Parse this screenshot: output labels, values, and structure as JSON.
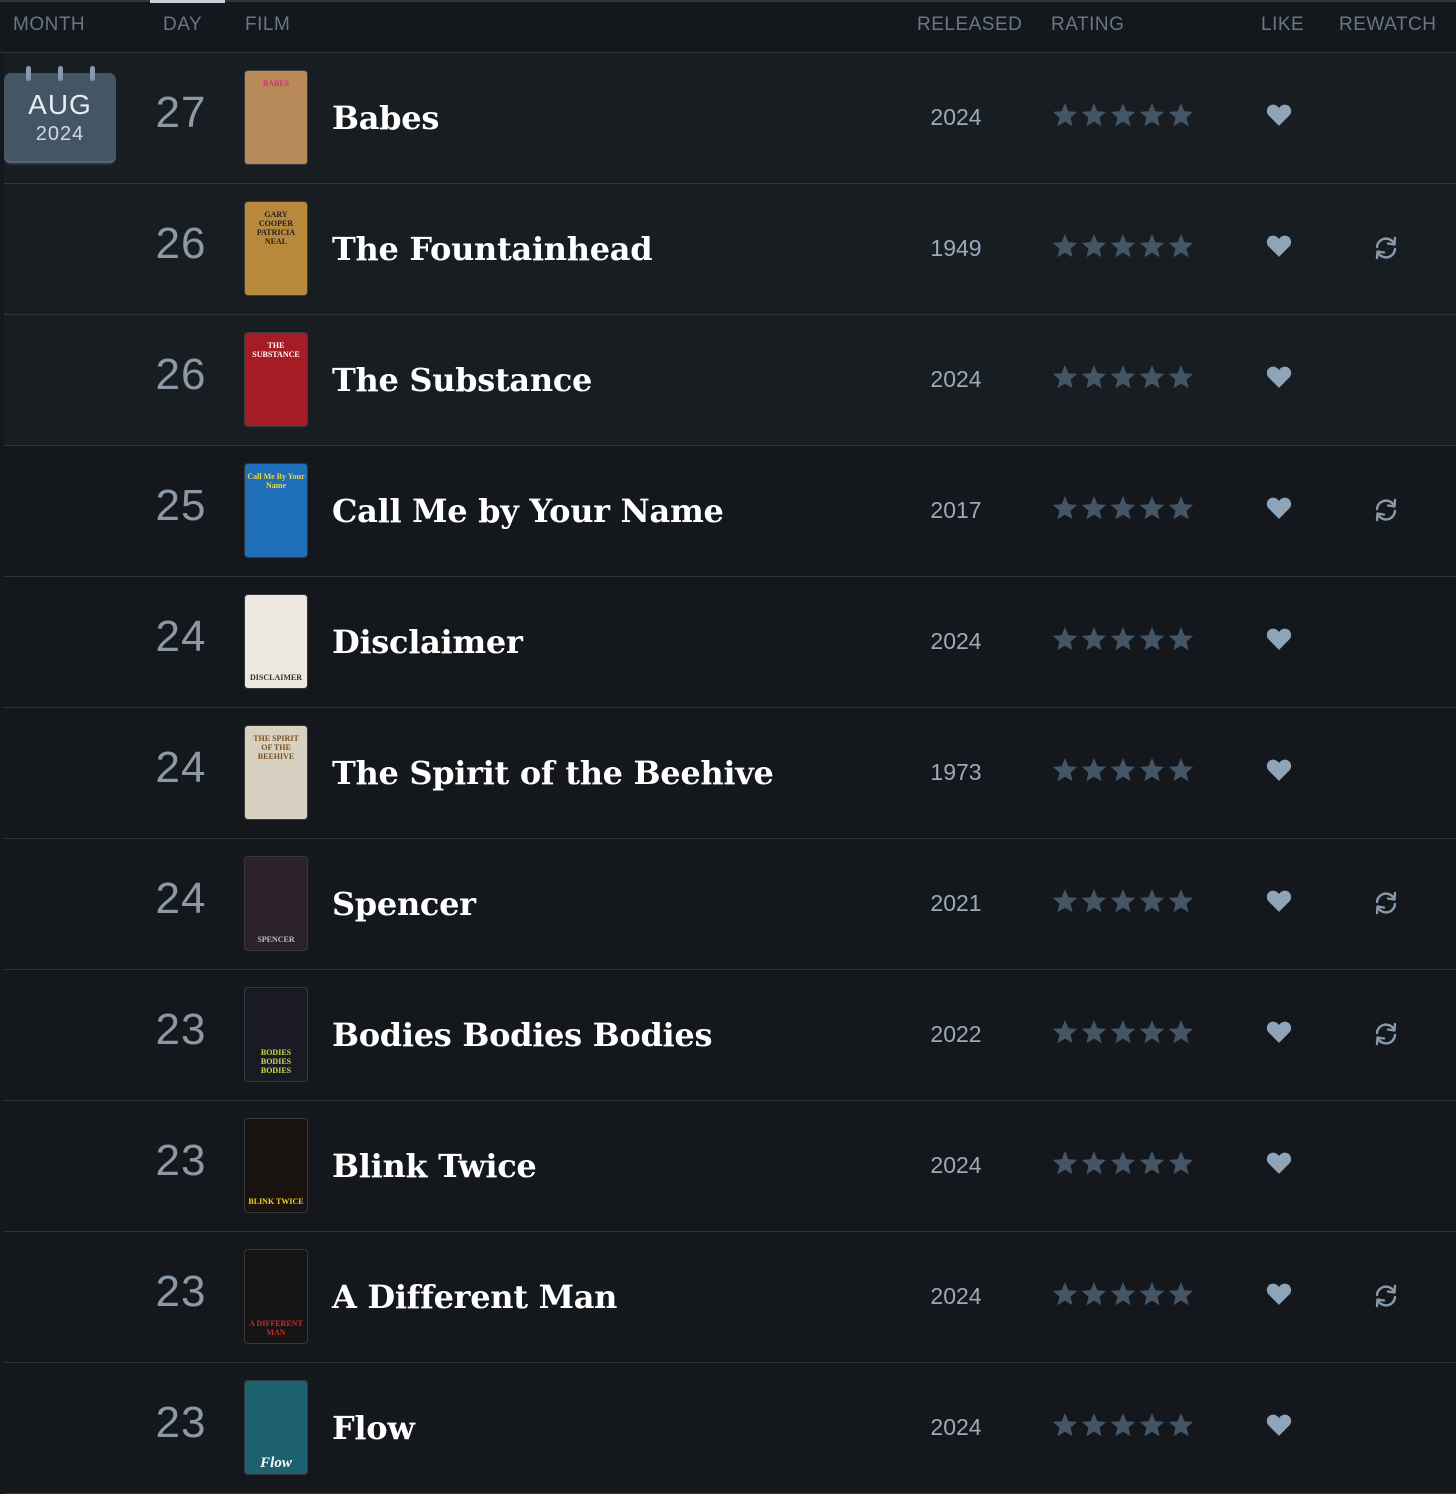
{
  "header": {
    "month": "MONTH",
    "day": "DAY",
    "film": "FILM",
    "released": "RELEASED",
    "rating": "RATING",
    "like": "LIKE",
    "rewatch": "REWATCH"
  },
  "calendar": {
    "month": "AUG",
    "year": "2024"
  },
  "entries": [
    {
      "day": "27",
      "title": "Babes",
      "year": "2024",
      "rating": 5,
      "liked": true,
      "rewatch": false,
      "poster": {
        "bg": "#b88a5a",
        "text": "BABES",
        "text_color": "#e8228a"
      }
    },
    {
      "day": "26",
      "title": "The Fountainhead",
      "year": "1949",
      "rating": 5,
      "liked": true,
      "rewatch": true,
      "poster": {
        "bg": "#b8893a",
        "text": "GARY COOPER PATRICIA NEAL",
        "text_color": "#222"
      }
    },
    {
      "day": "26",
      "title": "The Substance",
      "year": "2024",
      "rating": 5,
      "liked": true,
      "rewatch": false,
      "poster": {
        "bg": "#a51c25",
        "text": "THE SUBSTANCE",
        "text_color": "#fff"
      }
    },
    {
      "day": "25",
      "title": "Call Me by Your Name",
      "year": "2017",
      "rating": 5,
      "liked": true,
      "rewatch": true,
      "poster": {
        "bg": "#1f6fb8",
        "text": "Call Me By Your Name",
        "text_color": "#e8d840"
      }
    },
    {
      "day": "24",
      "title": "Disclaimer",
      "year": "2024",
      "rating": 5,
      "liked": true,
      "rewatch": false,
      "poster": {
        "bg": "#ece8e0",
        "text": "DISCLAIMER",
        "text_color": "#333"
      }
    },
    {
      "day": "24",
      "title": "The Spirit of the Beehive",
      "year": "1973",
      "rating": 5,
      "liked": true,
      "rewatch": false,
      "poster": {
        "bg": "#d8d0c0",
        "text": "THE SPIRIT OF THE BEEHIVE",
        "text_color": "#7a5020"
      }
    },
    {
      "day": "24",
      "title": "Spencer",
      "year": "2021",
      "rating": 5,
      "liked": true,
      "rewatch": true,
      "poster": {
        "bg": "#2a2228",
        "text": "SPENCER",
        "text_color": "#bbb"
      }
    },
    {
      "day": "23",
      "title": "Bodies Bodies Bodies",
      "year": "2022",
      "rating": 5,
      "liked": true,
      "rewatch": true,
      "poster": {
        "bg": "#1a1a24",
        "text": "BODIES BODIES BODIES",
        "text_color": "#c6e04a"
      }
    },
    {
      "day": "23",
      "title": "Blink Twice",
      "year": "2024",
      "rating": 5,
      "liked": true,
      "rewatch": false,
      "poster": {
        "bg": "#1a1410",
        "text": "BLINK TWICE",
        "text_color": "#f0d020"
      }
    },
    {
      "day": "23",
      "title": "A Different Man",
      "year": "2024",
      "rating": 5,
      "liked": true,
      "rewatch": true,
      "poster": {
        "bg": "#141414",
        "text": "A DIFFERENT MAN",
        "text_color": "#c0302a"
      }
    },
    {
      "day": "23",
      "title": "Flow",
      "year": "2024",
      "rating": 5,
      "liked": true,
      "rewatch": false,
      "poster": {
        "bg": "#1d6070",
        "text": "Flow",
        "text_color": "#fff"
      }
    }
  ],
  "colors": {
    "background": "#14181c",
    "star": "#456",
    "heart": "#8ea4b8",
    "rewatch": "#8899aa"
  }
}
